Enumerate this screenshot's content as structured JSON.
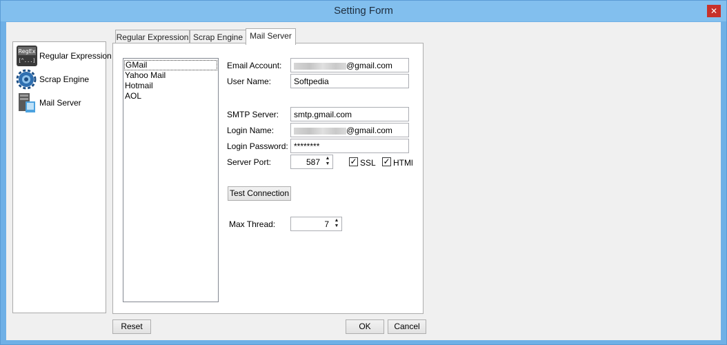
{
  "window": {
    "title": "Setting Form",
    "close_glyph": "✕"
  },
  "nav": {
    "items": [
      {
        "label": "Regular Expression",
        "icon": "regex-icon",
        "icon_text": "RegEx",
        "icon_sub": "[^...]"
      },
      {
        "label": "Scrap Engine",
        "icon": "gear-icon"
      },
      {
        "label": "Mail Server",
        "icon": "server-icon"
      }
    ]
  },
  "tabs": [
    "Regular Expression",
    "Scrap Engine",
    "Mail Server"
  ],
  "active_tab": "Mail Server",
  "providers": [
    "GMail",
    "Yahoo Mail",
    "Hotmail",
    "AOL"
  ],
  "selected_provider": "GMail",
  "form": {
    "email_account_label": "Email Account:",
    "email_account_suffix": "@gmail.com",
    "user_name_label": "User Name:",
    "user_name_value": "Softpedia",
    "smtp_server_label": "SMTP Server:",
    "smtp_server_value": "smtp.gmail.com",
    "login_name_label": "Login Name:",
    "login_name_suffix": "@gmail.com",
    "login_password_label": "Login Password:",
    "login_password_value": "********",
    "server_port_label": "Server Port:",
    "server_port_value": "587",
    "ssl_label": "SSL",
    "ssl_checked": true,
    "html_label": "HTMl",
    "html_checked": true,
    "test_connection_label": "Test Connection",
    "max_thread_label": "Max Thread:",
    "max_thread_value": "7"
  },
  "buttons": {
    "reset": "Reset",
    "ok": "OK",
    "cancel": "Cancel"
  },
  "glyphs": {
    "check": "✓",
    "spin_up": "▲",
    "spin_down": "▼"
  },
  "colors": {
    "titlebar": "#82bfee",
    "close": "#c7312a",
    "client": "#f0f0f0"
  }
}
